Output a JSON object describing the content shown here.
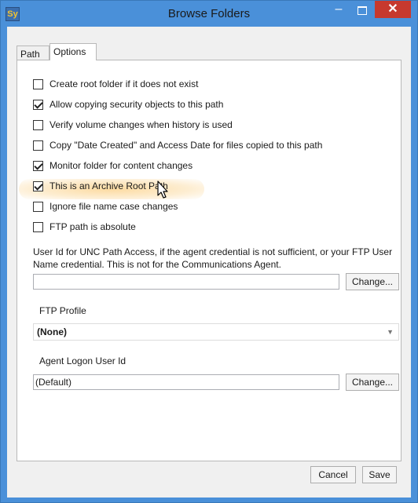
{
  "window": {
    "title": "Browse Folders",
    "app_icon": "Sy"
  },
  "tabs": [
    {
      "label": "Path"
    },
    {
      "label": "Options"
    }
  ],
  "options": [
    {
      "label": "Create root folder if it does not exist",
      "checked": false
    },
    {
      "label": "Allow copying security objects to this path",
      "checked": true
    },
    {
      "label": "Verify volume changes when history is used",
      "checked": false
    },
    {
      "label": "Copy \"Date Created\" and Access Date for files copied to this path",
      "checked": false
    },
    {
      "label": "Monitor folder for content changes",
      "checked": true
    },
    {
      "label": "This is an Archive Root Path",
      "checked": true
    },
    {
      "label": "Ignore file name case changes",
      "checked": false
    },
    {
      "label": "FTP path is absolute",
      "checked": false
    }
  ],
  "unc": {
    "label": "User Id for UNC Path Access, if the agent credential is not sufficient, or your FTP User Name credential. This is not for the Communications Agent.",
    "value": "",
    "change_label": "Change..."
  },
  "ftp_profile": {
    "label": "FTP Profile",
    "selected": "(None)"
  },
  "agent_logon": {
    "label": "Agent Logon User Id",
    "value": "(Default)",
    "change_label": "Change..."
  },
  "footer": {
    "cancel_label": "Cancel",
    "save_label": "Save"
  }
}
